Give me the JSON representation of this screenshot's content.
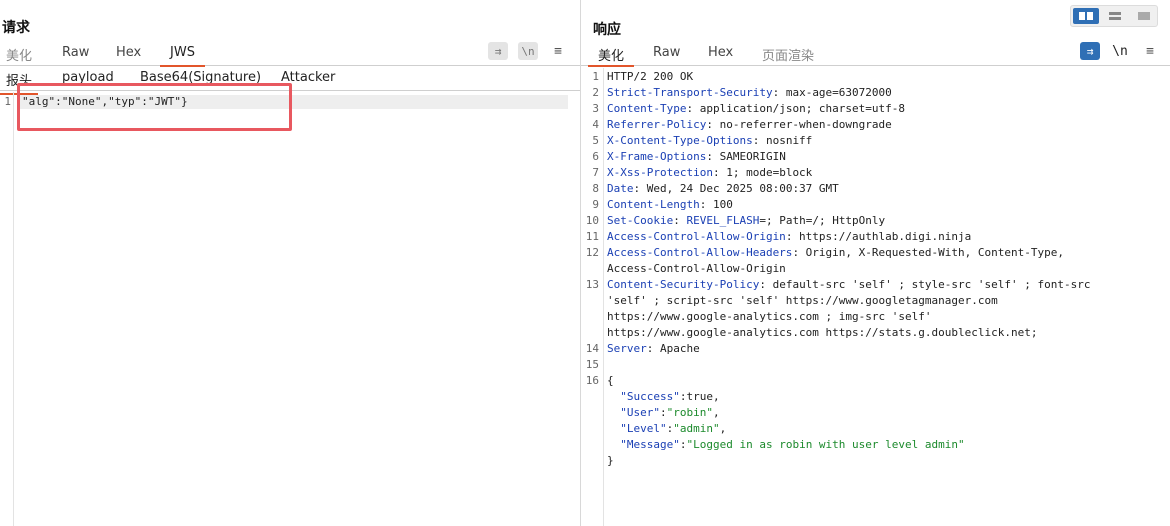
{
  "request": {
    "title": "请求",
    "tabs": [
      "美化",
      "Raw",
      "Hex",
      "JWS"
    ],
    "subtabs": [
      "报头",
      "payload",
      "Base64(Signature)",
      "Attacker"
    ],
    "tools": {
      "wrap": "⇉",
      "newline": "\\n",
      "menu": "≡"
    },
    "line_number": "1",
    "code_line": "\"alg\":\"None\",\"typ\":\"JWT\"}"
  },
  "response": {
    "title": "响应",
    "tabs": [
      "美化",
      "Raw",
      "Hex",
      "页面渲染"
    ],
    "tools": {
      "wrap": "⇉",
      "newline": "\\n",
      "menu": "≡"
    },
    "lines": [
      {
        "n": "1",
        "key": "",
        "val": "HTTP/2 200 OK"
      },
      {
        "n": "2",
        "key": "Strict-Transport-Security",
        "val": ": max-age=63072000"
      },
      {
        "n": "3",
        "key": "Content-Type",
        "val": ": application/json; charset=utf-8"
      },
      {
        "n": "4",
        "key": "Referrer-Policy",
        "val": ": no-referrer-when-downgrade"
      },
      {
        "n": "5",
        "key": "X-Content-Type-Options",
        "val": ": nosniff"
      },
      {
        "n": "6",
        "key": "X-Frame-Options",
        "val": ": SAMEORIGIN"
      },
      {
        "n": "7",
        "key": "X-Xss-Protection",
        "val": ": 1; mode=block"
      },
      {
        "n": "8",
        "key": "Date",
        "val": ": Wed, 24 Dec 2025 08:00:37 GMT"
      },
      {
        "n": "9",
        "key": "Content-Length",
        "val": ": 100"
      },
      {
        "n": "10",
        "key": "Set-Cookie",
        "val": ": ",
        "key2": "REVEL_FLASH",
        "val2": "=; Path=/; HttpOnly"
      },
      {
        "n": "11",
        "key": "Access-Control-Allow-Origin",
        "val": ": https://authlab.digi.ninja"
      },
      {
        "n": "12",
        "key": "Access-Control-Allow-Headers",
        "val": ": Origin, X-Requested-With, Content-Type,"
      },
      {
        "n": "",
        "key": "",
        "val": "Access-Control-Allow-Origin"
      },
      {
        "n": "13",
        "key": "Content-Security-Policy",
        "val": ": default-src 'self' ; style-src 'self' ; font-src"
      },
      {
        "n": "",
        "key": "",
        "val": "'self' ; script-src 'self' https://www.googletagmanager.com"
      },
      {
        "n": "",
        "key": "",
        "val": "https://www.google-analytics.com ; img-src 'self'"
      },
      {
        "n": "",
        "key": "",
        "val": "https://www.google-analytics.com https://stats.g.doubleclick.net;"
      },
      {
        "n": "14",
        "key": "Server",
        "val": ": Apache"
      },
      {
        "n": "15",
        "key": "",
        "val": ""
      },
      {
        "n": "16",
        "key": "",
        "val": "{"
      }
    ],
    "json": [
      {
        "key": "\"Success\"",
        "val": ":true,",
        "str": false
      },
      {
        "key": "\"User\"",
        "val": "\"robin\"",
        "str": true
      },
      {
        "key": "\"Level\"",
        "val": "\"admin\"",
        "str": true
      },
      {
        "key": "\"Message\"",
        "val": "\"Logged in as robin with user level admin\"",
        "str": true
      }
    ],
    "close_brace": "}"
  }
}
